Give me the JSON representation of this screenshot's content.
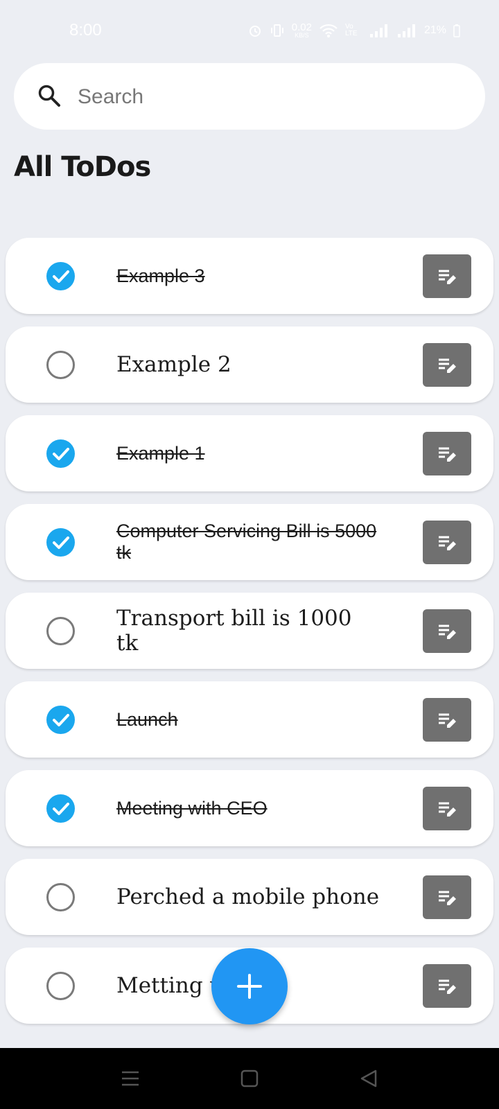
{
  "status_bar": {
    "time": "8:00",
    "data_speed": "0.02",
    "data_speed_unit": "KB/S",
    "volte": "Vo LTE",
    "battery": "21%"
  },
  "search": {
    "placeholder": "Search",
    "value": ""
  },
  "page": {
    "title": "All ToDos"
  },
  "todos": [
    {
      "text": "Example 3",
      "done": true
    },
    {
      "text": "Example 2",
      "done": false
    },
    {
      "text": "Example 1",
      "done": true
    },
    {
      "text": "Computer Servicing Bill is 5000 tk",
      "done": true
    },
    {
      "text": "Transport bill is 1000 tk",
      "done": false
    },
    {
      "text": "Launch",
      "done": true
    },
    {
      "text": "Meeting with CEO",
      "done": true
    },
    {
      "text": "Perched a mobile phone",
      "done": false
    },
    {
      "text": "Metting with s",
      "done": false
    }
  ],
  "icons": {
    "search": "search-icon",
    "check_done": "check-circle-icon",
    "check_open": "empty-circle-icon",
    "edit": "edit-note-icon",
    "add": "plus-icon"
  },
  "colors": {
    "accent": "#1aa7ee",
    "fab": "#2196f3",
    "edit_button": "#707070",
    "background": "#eceef3"
  }
}
